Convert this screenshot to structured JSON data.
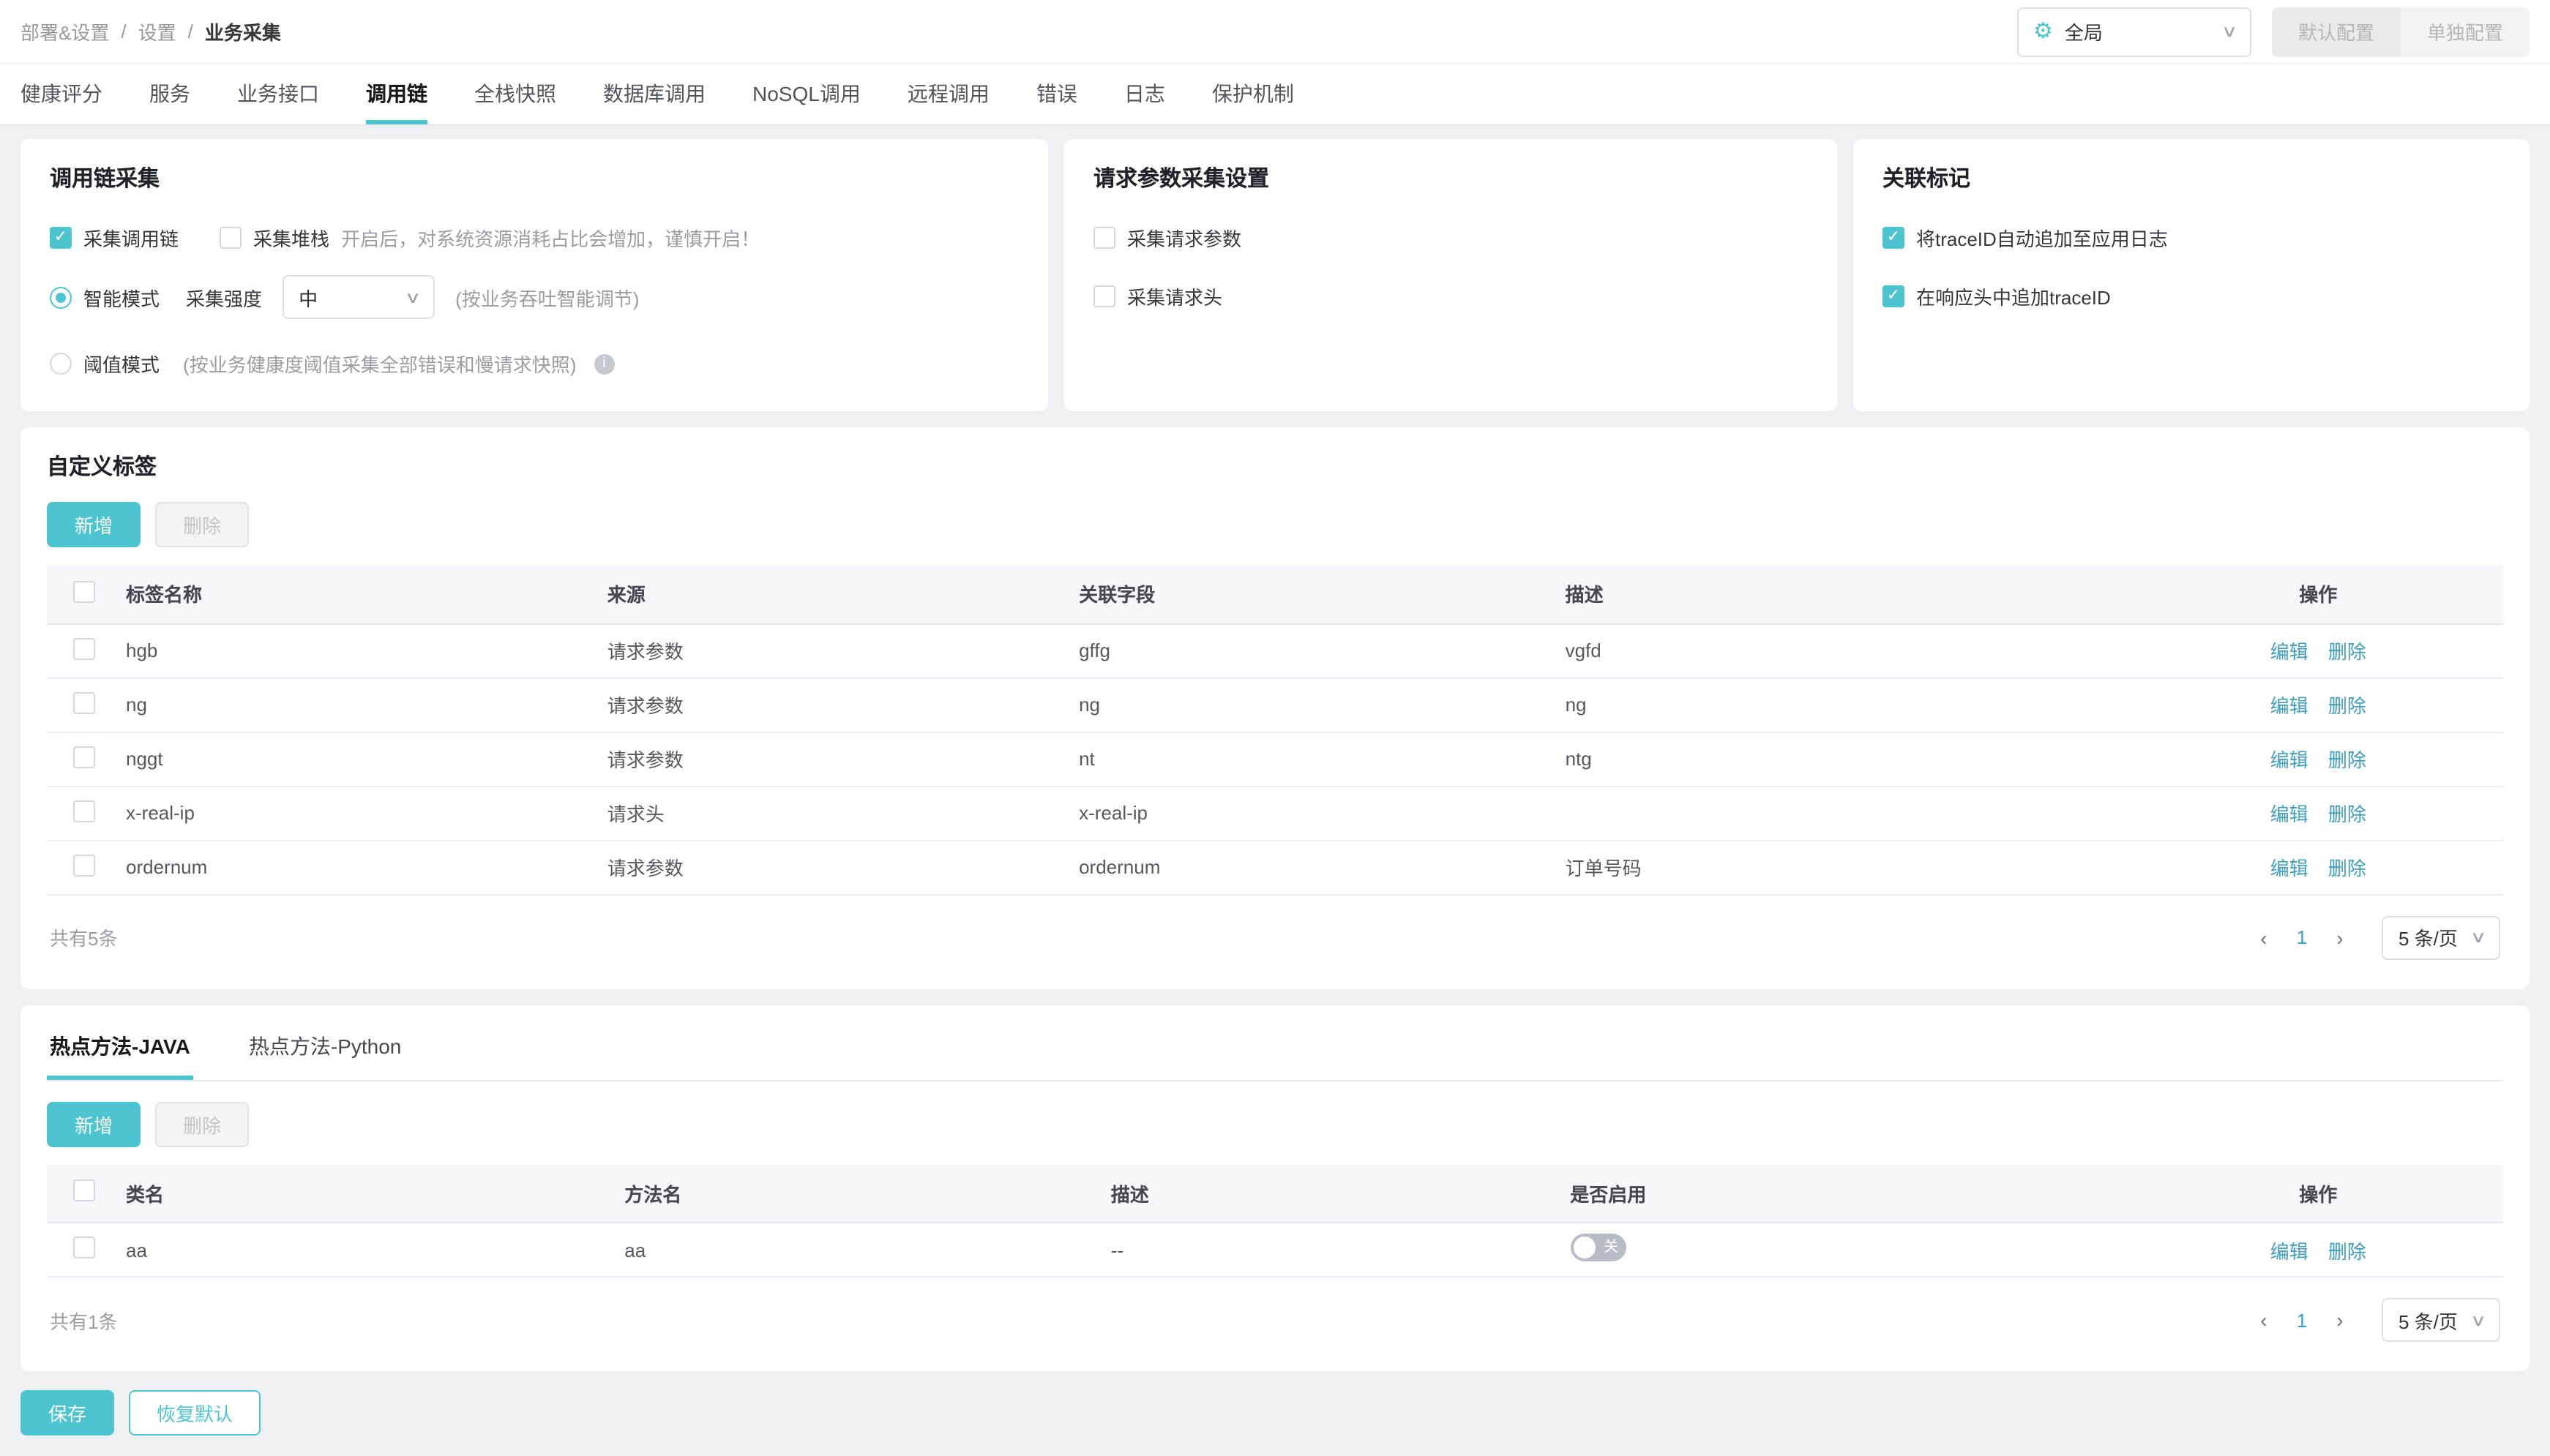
{
  "header": {
    "breadcrumb": [
      "部署&设置",
      "设置",
      "业务采集"
    ],
    "scope_select": {
      "icon": "gear-icon",
      "value": "全局"
    },
    "config_buttons": [
      {
        "label": "默认配置"
      },
      {
        "label": "单独配置"
      }
    ]
  },
  "tabs": {
    "items": [
      "健康评分",
      "服务",
      "业务接口",
      "调用链",
      "全栈快照",
      "数据库调用",
      "NoSQL调用",
      "远程调用",
      "错误",
      "日志",
      "保护机制"
    ],
    "active": "调用链"
  },
  "cards": {
    "trace_collect": {
      "title": "调用链采集",
      "collect_trace": {
        "label": "采集调用链",
        "checked": true
      },
      "collect_stack": {
        "label": "采集堆栈",
        "checked": false
      },
      "stack_hint": "开启后，对系统资源消耗占比会增加，谨慎开启！",
      "smart_mode": {
        "label": "智能模式",
        "selected": true
      },
      "intensity_label": "采集强度",
      "intensity_value": "中",
      "smart_hint": "(按业务吞吐智能调节)",
      "threshold_mode": {
        "label": "阈值模式",
        "selected": false
      },
      "threshold_hint": "(按业务健康度阈值采集全部错误和慢请求快照)"
    },
    "request_params": {
      "title": "请求参数采集设置",
      "items": [
        {
          "label": "采集请求参数",
          "checked": false
        },
        {
          "label": "采集请求头",
          "checked": false
        }
      ]
    },
    "correlation": {
      "title": "关联标记",
      "items": [
        {
          "label": "将traceID自动追加至应用日志",
          "checked": true
        },
        {
          "label": "在响应头中追加traceID",
          "checked": true
        }
      ]
    }
  },
  "custom_tags": {
    "title": "自定义标签",
    "add_label": "新增",
    "delete_label": "删除",
    "columns": [
      "标签名称",
      "来源",
      "关联字段",
      "描述",
      "操作"
    ],
    "rows": [
      {
        "name": "hgb",
        "source": "请求参数",
        "field": "gffg",
        "desc": "vgfd"
      },
      {
        "name": "ng",
        "source": "请求参数",
        "field": "ng",
        "desc": "ng"
      },
      {
        "name": "nggt",
        "source": "请求参数",
        "field": "nt",
        "desc": "ntg"
      },
      {
        "name": "x-real-ip",
        "source": "请求头",
        "field": "x-real-ip",
        "desc": ""
      },
      {
        "name": "ordernum",
        "source": "请求参数",
        "field": "ordernum",
        "desc": "订单号码"
      }
    ],
    "edit_label": "编辑",
    "delete_row_label": "删除",
    "total": "共有5条",
    "page": "1",
    "page_size": "5 条/页"
  },
  "hot_methods": {
    "tabs": [
      "热点方法-JAVA",
      "热点方法-Python"
    ],
    "active": "热点方法-JAVA",
    "add_label": "新增",
    "delete_label": "删除",
    "columns": [
      "类名",
      "方法名",
      "描述",
      "是否启用",
      "操作"
    ],
    "rows": [
      {
        "class_name": "aa",
        "method_name": "aa",
        "desc": "--",
        "enabled": false
      }
    ],
    "toggle_off_label": "关",
    "edit_label": "编辑",
    "delete_row_label": "删除",
    "total": "共有1条",
    "page": "1",
    "page_size": "5 条/页"
  },
  "footer": {
    "save_label": "保存",
    "reset_label": "恢复默认"
  },
  "colors": {
    "accent": "#4dc5d0",
    "link": "#3f9fbe",
    "page_bg": "#eef0f4"
  }
}
